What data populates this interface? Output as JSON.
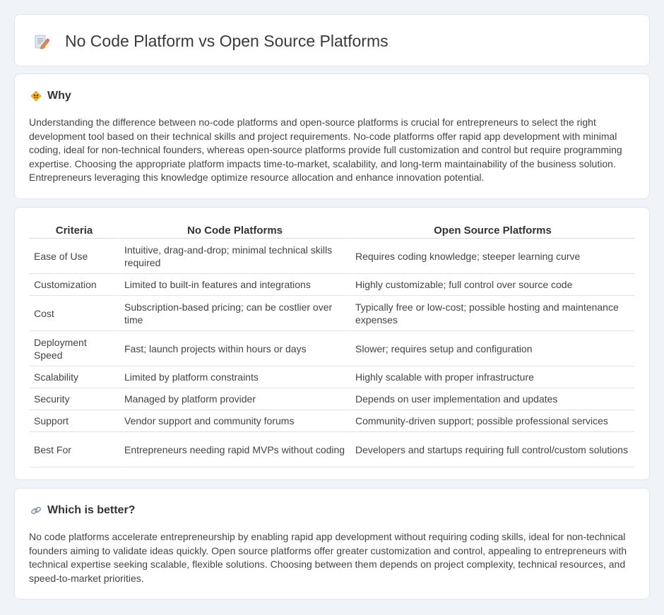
{
  "header": {
    "title": "No Code Platform vs Open Source Platforms",
    "icon": "document-pencil-icon"
  },
  "why": {
    "title": "Why",
    "icon": "diamond-sign-icon",
    "body": "Understanding the difference between no-code platforms and open-source platforms is crucial for entrepreneurs to select the right development tool based on their technical skills and project requirements. No-code platforms offer rapid app development with minimal coding, ideal for non-technical founders, whereas open-source platforms provide full customization and control but require programming expertise. Choosing the appropriate platform impacts time-to-market, scalability, and long-term maintainability of the business solution. Entrepreneurs leveraging this knowledge optimize resource allocation and enhance innovation potential."
  },
  "table": {
    "headers": [
      "Criteria",
      "No Code Platforms",
      "Open Source Platforms"
    ],
    "rows": [
      [
        "Ease of Use",
        "Intuitive, drag-and-drop; minimal technical skills required",
        "Requires coding knowledge; steeper learning curve"
      ],
      [
        "Customization",
        "Limited to built-in features and integrations",
        "Highly customizable; full control over source code"
      ],
      [
        "Cost",
        "Subscription-based pricing; can be costlier over time",
        "Typically free or low-cost; possible hosting and maintenance expenses"
      ],
      [
        "Deployment Speed",
        "Fast; launch projects within hours or days",
        "Slower; requires setup and configuration"
      ],
      [
        "Scalability",
        "Limited by platform constraints",
        "Highly scalable with proper infrastructure"
      ],
      [
        "Security",
        "Managed by platform provider",
        "Depends on user implementation and updates"
      ],
      [
        "Support",
        "Vendor support and community forums",
        "Community-driven support; possible professional services"
      ],
      [
        "Best For",
        "Entrepreneurs needing rapid MVPs without coding",
        "Developers and startups requiring full control/custom solutions"
      ]
    ]
  },
  "better": {
    "title": "Which is better?",
    "icon": "link-icon",
    "body": "No code platforms accelerate entrepreneurship by enabling rapid app development without requiring coding skills, ideal for non-technical founders aiming to validate ideas quickly. Open source platforms offer greater customization and control, appealing to entrepreneurs with technical expertise seeking scalable, flexible solutions. Choosing between them depends on project complexity, technical resources, and speed-to-market priorities."
  }
}
